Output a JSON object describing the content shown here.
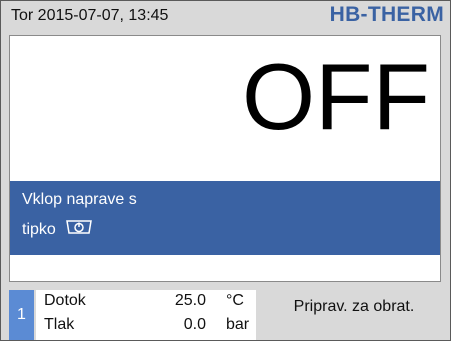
{
  "header": {
    "datetime": "Tor  2015-07-07, 13:45",
    "logo": "HB-THERM"
  },
  "main": {
    "state": "OFF",
    "message_line1": "Vklop naprave s",
    "message_line2": "tipko",
    "message_icon": "power-key-icon"
  },
  "bottom": {
    "tab_number": "1",
    "params": [
      {
        "name": "Dotok",
        "value": "25.0",
        "unit": "°C"
      },
      {
        "name": "Tlak",
        "value": "0.0",
        "unit": "bar"
      }
    ],
    "status": "Priprav. za obrat."
  },
  "colors": {
    "accent": "#3a62a3",
    "tab": "#5b8bd4",
    "background": "#d9d9d9"
  }
}
